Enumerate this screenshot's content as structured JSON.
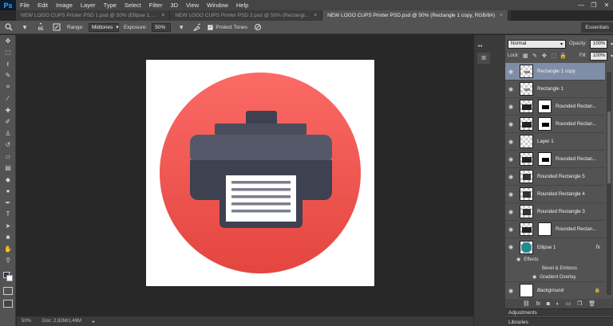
{
  "app": {
    "logo": "Ps"
  },
  "menu": [
    "File",
    "Edit",
    "Image",
    "Layer",
    "Type",
    "Select",
    "Filter",
    "3D",
    "View",
    "Window",
    "Help"
  ],
  "window_controls": {
    "minimize": "—",
    "maximize": "❐",
    "close": "✕"
  },
  "tabs": [
    {
      "label": "NEW LOGO CUPS Printer PSD 1.psd @ 50% (Ellipse 1, ...",
      "active": false
    },
    {
      "label": "NEW LOGO CUPS Printer PSD 2.psd @ 50% (Rectangl...",
      "active": false
    },
    {
      "label": "NEW LOGO CUPS Printer PSD.psd @ 50% (Rectangle 1 copy, RGB/8#)",
      "active": true
    }
  ],
  "tab_close": "×",
  "options": {
    "brush_size": "65",
    "range_label": "Range:",
    "range_value": "Midtones",
    "exposure_label": "Exposure:",
    "exposure_value": "50%",
    "protect_label": "Protect Tones",
    "essentials": "Essentials"
  },
  "tools": [
    "move-tool",
    "marquee-tool",
    "lasso-tool",
    "quick-select-tool",
    "crop-tool",
    "eyedropper-tool",
    "healing-tool",
    "brush-tool",
    "clone-stamp-tool",
    "history-brush-tool",
    "eraser-tool",
    "gradient-tool",
    "blur-tool",
    "dodge-tool",
    "pen-tool",
    "type-tool",
    "path-select-tool",
    "shape-tool",
    "hand-tool",
    "zoom-tool",
    "edit-toolbar"
  ],
  "status": {
    "zoom": "50%",
    "doc": "Doc: 2,92M/1,49M"
  },
  "layers_panel": {
    "blend_mode": "Normal",
    "opacity_label": "Opacity:",
    "opacity_value": "100%",
    "lock_label": "Lock:",
    "fill_label": "Fill:",
    "fill_value": "100%",
    "layers": [
      {
        "name": "Rectangle 1 copy",
        "selected": true,
        "type": "plain"
      },
      {
        "name": "Rectangle 1",
        "selected": false,
        "type": "plain"
      },
      {
        "name": "Rounded Rectan...",
        "selected": false,
        "type": "masked"
      },
      {
        "name": "Rounded Rectan...",
        "selected": false,
        "type": "masked"
      },
      {
        "name": "Layer 1",
        "selected": false,
        "type": "plain"
      },
      {
        "name": "Rounded Rectan...",
        "selected": false,
        "type": "masked"
      },
      {
        "name": "Rounded Rectangle 5",
        "selected": false,
        "type": "plain"
      },
      {
        "name": "Rounded Rectangle 4",
        "selected": false,
        "type": "plain"
      },
      {
        "name": "Rounded Rectangle 3",
        "selected": false,
        "type": "plain"
      },
      {
        "name": "Rounded Rectan...",
        "selected": false,
        "type": "masked"
      },
      {
        "name": "Ellipse 1",
        "selected": false,
        "type": "ellipse",
        "fx": "fx"
      }
    ],
    "effects_label": "Effects",
    "effects": [
      "Bevel & Emboss",
      "Gradient Overlay"
    ],
    "background_name": "Background",
    "adjustments": "Adjustments",
    "libraries": "Libraries"
  },
  "colors": {
    "accent_circle_top": "#f75d5d",
    "accent_circle_bottom": "#e84a48",
    "printer_dark": "#3e4150",
    "printer_mid": "#555868",
    "selected_layer": "#7f8ea6",
    "ellipse_thumb": "#1f8a8f"
  }
}
